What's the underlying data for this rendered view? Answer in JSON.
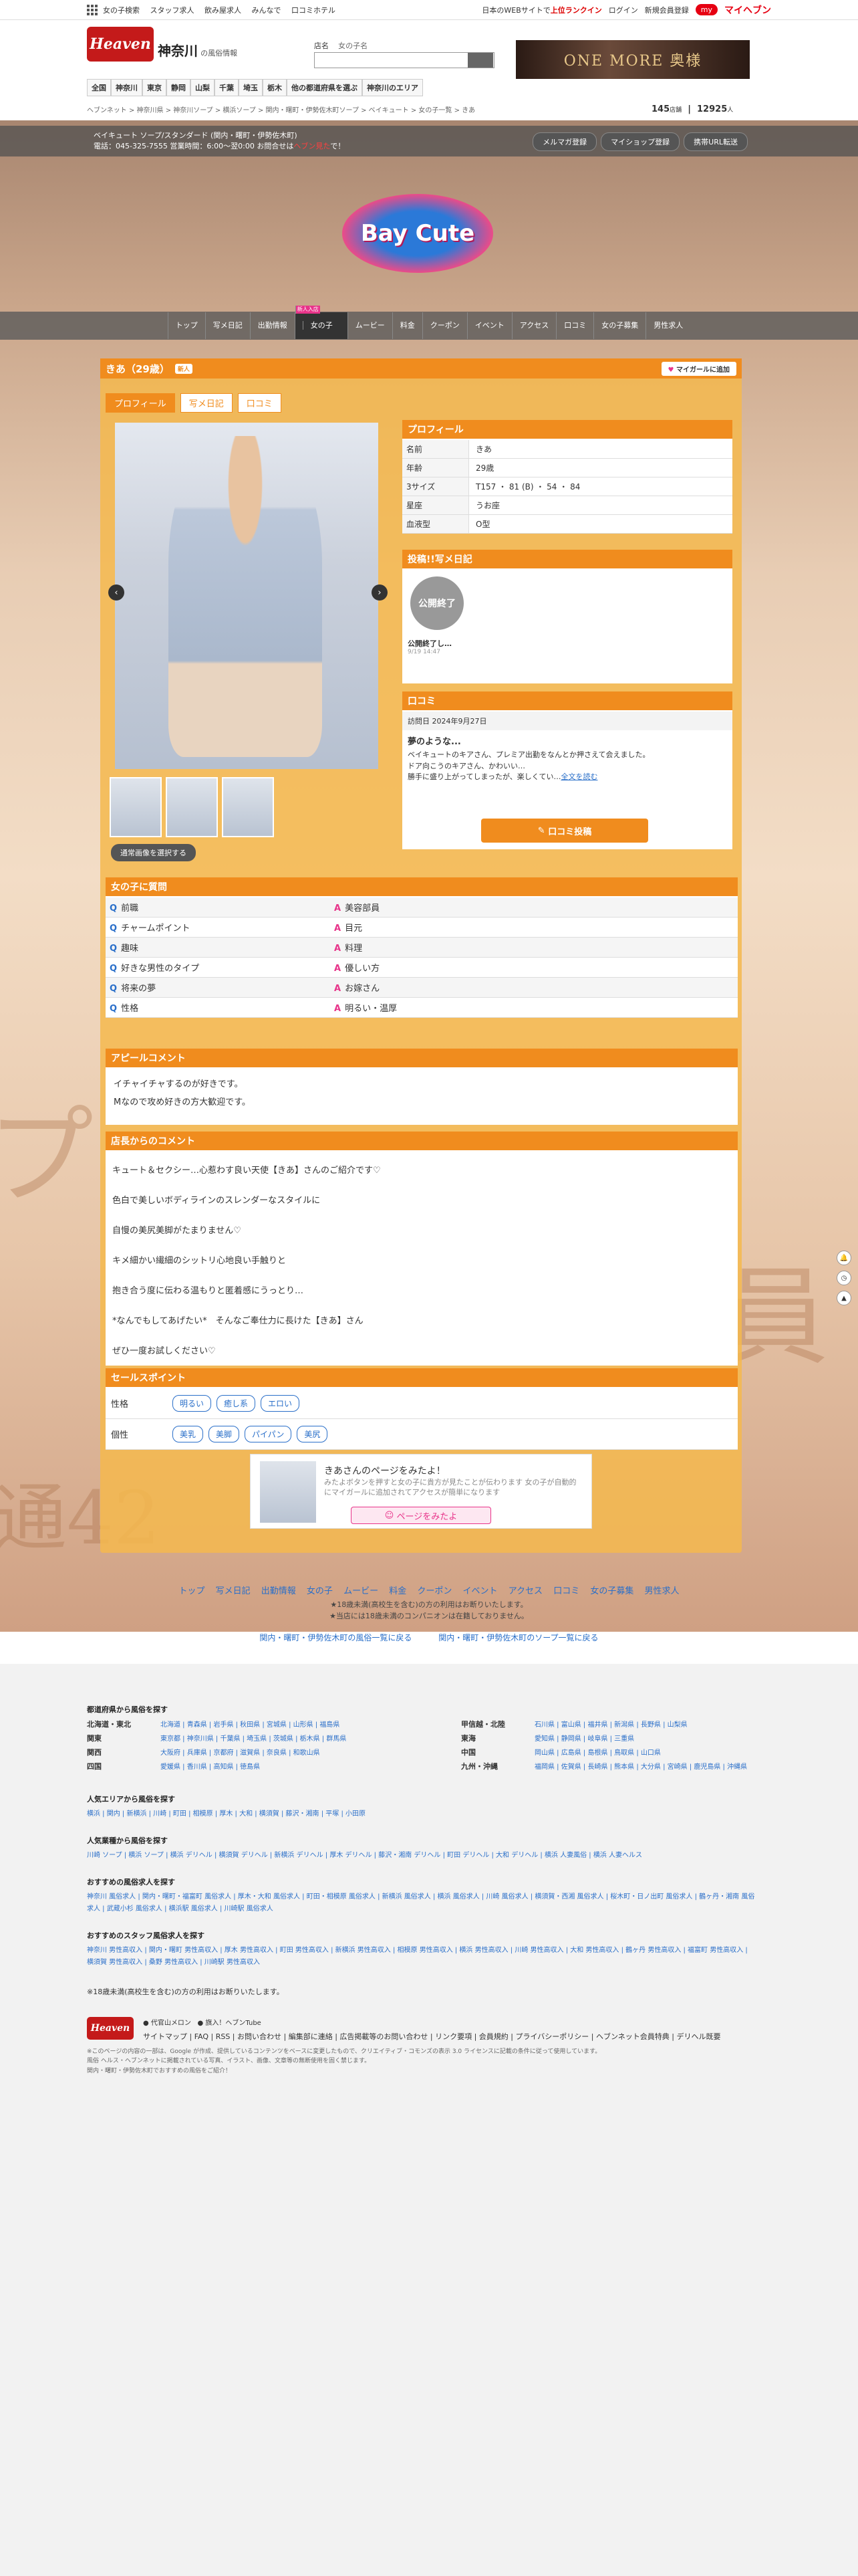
{
  "topbar": {
    "links": [
      "女の子検索",
      "スタッフ求人",
      "飲み屋求人",
      "みんなで",
      "口コミホテル"
    ],
    "right_text": "日本のWEBサイトで",
    "rank_text": "上位ランクイン",
    "login": "ログイン",
    "register": "新規会員登録",
    "my_badge": "my",
    "my_label": "マイヘブン"
  },
  "header": {
    "logo_text": "Heaven",
    "region_big": "神奈川",
    "region_small": "の風俗情報",
    "search_label": "店名",
    "search_value": "女の子名",
    "banner_text": "ONE MORE 奥様"
  },
  "areanav": [
    "全国",
    "神奈川",
    "東京",
    "静岡",
    "山梨",
    "千葉",
    "埼玉",
    "栃木",
    "他の都道府県を選ぶ",
    "神奈川のエリア"
  ],
  "breadcrumb": "ヘブンネット > 神奈川県 > 神奈川ソープ > 横浜ソープ > 関内・曙町・伊勢佐木町ソープ > ベイキュート > 女の子一覧 > きあ",
  "counts": {
    "shops": "145",
    "shops_unit": "店舗",
    "girls": "12925",
    "girls_unit": "人"
  },
  "shopbar": {
    "line1": "ベイキュート ソープ/スタンダード (関内・曙町・伊勢佐木町)",
    "line2": "電話：045-325-7555 営業時間：6:00〜翌0:00 お問合せは",
    "line2_highlight": "ヘブン見た",
    "line2_end": "で！",
    "buttons": [
      "メルマガ登録",
      "マイショップ登録",
      "携帯URL転送"
    ]
  },
  "shop_logo": "Bay Cute",
  "shopnav": [
    "トップ",
    "写メ日記",
    "出勤情報",
    "女の子",
    "ムービー",
    "料金",
    "クーポン",
    "イベント",
    "アクセス",
    "口コミ",
    "女の子募集",
    "男性求人"
  ],
  "shopnav_badge": "新人入店",
  "girl": {
    "name": "きあ（29歳）",
    "badge": "新人",
    "mylist": "マイガールに追加",
    "tabs": [
      "プロフィール",
      "写メ日記",
      "口コミ"
    ]
  },
  "profile": {
    "title": "プロフィール",
    "rows": [
      {
        "k": "名前",
        "v": "きあ"
      },
      {
        "k": "年齢",
        "v": "29歳"
      },
      {
        "k": "3サイズ",
        "v": "T157 ・ 81 (B) ・ 54 ・ 84"
      },
      {
        "k": "星座",
        "v": "うお座"
      },
      {
        "k": "血液型",
        "v": "O型"
      }
    ]
  },
  "diary": {
    "title": "投稿!!写メ日記",
    "card_circle": "公開終了",
    "card_title": "公開終了し…",
    "card_date": "9/19 14:47"
  },
  "review": {
    "title": "口コミ",
    "date": "訪問日  2024年9月27日",
    "heading": "夢のような...",
    "body1": "ベイキュートのキアさん、プレミア出勤をなんとか押さえて会えました。",
    "body2": "ドア向こうのキアさん、かわいい…",
    "body3": "勝手に盛り上がってしまったが、楽しくてい…",
    "more": "全文を読む",
    "post_button": "口コミ投稿"
  },
  "photo_controls": {
    "prev": "‹",
    "next": "›",
    "select_button": "通常画像を選択する"
  },
  "qa": {
    "title": "女の子に質問",
    "rows": [
      {
        "q": "前職",
        "a": "美容部員"
      },
      {
        "q": "チャームポイント",
        "a": "目元"
      },
      {
        "q": "趣味",
        "a": "料理"
      },
      {
        "q": "好きな男性のタイプ",
        "a": "優しい方"
      },
      {
        "q": "将来の夢",
        "a": "お嫁さん"
      },
      {
        "q": "性格",
        "a": "明るい・温厚"
      }
    ]
  },
  "appeal": {
    "title": "アピールコメント",
    "line1": "イチャイチャするのが好きです。",
    "line2": "Mなので攻め好きの方大歓迎です。"
  },
  "shop_comment": {
    "title": "店長からのコメント",
    "lines": [
      "キュート＆セクシー…心惹わす良い天使【きあ】さんのご紹介です♡",
      "色白で美しいボディラインのスレンダーなスタイルに",
      "自慢の美尻美脚がたまりません♡",
      "キメ細かい繊細のシットリ心地良い手触りと",
      "抱き合う度に伝わる温もりと匿着感にうっとり…",
      "*なんでもしてあげたい*　そんなご奉仕力に長けた【きあ】さん",
      "ぜひ一度お試しください♡"
    ]
  },
  "sales": {
    "title": "セールスポイント",
    "rows": [
      {
        "k": "性格",
        "tags": [
          "明るい",
          "癒し系",
          "エロい"
        ]
      },
      {
        "k": "個性",
        "tags": [
          "美乳",
          "美脚",
          "パイパン",
          "美尻"
        ]
      }
    ]
  },
  "promo": {
    "title": "きあさんのページをみたよ！",
    "text": "みたよボタンを押すと女の子に貴方が見たことが伝わります 女の子が自動的にマイガールに追加されてアクセスが簡単になります",
    "button": "ページをみたよ"
  },
  "footnav": [
    "トップ",
    "写メ日記",
    "出勤情報",
    "女の子",
    "ムービー",
    "料金",
    "クーポン",
    "イベント",
    "アクセス",
    "口コミ",
    "女の子募集",
    "男性求人"
  ],
  "age_note1": "★18歳未満(高校生を含む)の方の利用はお断りいたします。",
  "age_note2": "★当店には18歳未満のコンパニオンは在籍しておりません。",
  "backlinks": [
    "関内・曙町・伊勢佐木町の風俗一覧に戻る",
    "関内・曙町・伊勢佐木町のソープ一覧に戻る"
  ],
  "footer": {
    "pref_title": "都道府県から風俗を探す",
    "pref_left": [
      {
        "k": "北海道・東北",
        "v": "北海道 | 青森県 | 岩手県 | 秋田県 | 宮城県 | 山形県 | 福島県"
      },
      {
        "k": "関東",
        "v": "東京都 | 神奈川県 | 千葉県 | 埼玉県 | 茨城県 | 栃木県 | 群馬県"
      },
      {
        "k": "関西",
        "v": "大阪府 | 兵庫県 | 京都府 | 滋賀県 | 奈良県 | 和歌山県"
      },
      {
        "k": "四国",
        "v": "愛媛県 | 香川県 | 高知県 | 徳島県"
      }
    ],
    "pref_right": [
      {
        "k": "甲信越・北陸",
        "v": "石川県 | 富山県 | 福井県 | 新潟県 | 長野県 | 山梨県"
      },
      {
        "k": "東海",
        "v": "愛知県 | 静岡県 | 岐阜県 | 三重県"
      },
      {
        "k": "中国",
        "v": "岡山県 | 広島県 | 島根県 | 鳥取県 | 山口県"
      },
      {
        "k": "九州・沖縄",
        "v": "福岡県 | 佐賀県 | 長崎県 | 熊本県 | 大分県 | 宮崎県 | 鹿児島県 | 沖縄県"
      }
    ],
    "popular_title": "人気エリアから風俗を探す",
    "popular": "横浜 | 関内 | 新横浜 | 川崎 | 町田 | 相模原 | 厚木 | 大和 | 横須賀 | 藤沢・湘南 | 平塚 | 小田原",
    "type_title": "人気業種から風俗を探す",
    "types": "川崎 ソープ | 横浜 ソープ | 横浜 デリヘル | 横須賀 デリヘル | 新横浜 デリヘル | 厚木 デリヘル | 藤沢・湘南 デリヘル | 町田 デリヘル | 大和 デリヘル | 横浜 人妻風俗 | 横浜 人妻ヘルス",
    "job_title": "おすすめの風俗求人を探す",
    "jobs": "神奈川 風俗求人 | 関内・曙町・福富町 風俗求人 | 厚木・大和 風俗求人 | 町田・相模原 風俗求人 | 新横浜 風俗求人 | 横浜 風俗求人 | 川崎 風俗求人 | 横須賀・西湘 風俗求人 | 桜木町・日ノ出町 風俗求人 | 鶴ヶ丹・湘南 風俗求人 | 武蔵小杉 風俗求人 | 横浜駅 風俗求人 | 川崎駅 風俗求人",
    "staff_title": "おすすめのスタッフ風俗求人を探す",
    "staff": "神奈川 男性高収入 | 関内・曙町 男性高収入 | 厚木 男性高収入 | 町田 男性高収入 | 新横浜 男性高収入 | 相模原 男性高収入 | 横浜 男性高収入 | 川崎 男性高収入 | 大和 男性高収入 | 鶴ヶ丹 男性高収入 | 福富町 男性高収入 | 横須賀 男性高収入 | 桑野 男性高収入 | 川崎駅 男性高収入",
    "age_note": "※18歳未満(高校生を含む)の方の利用はお断りいたします。",
    "logo": "Heaven",
    "partner1": "代官山メロン",
    "partner2": "旗入！ヘブンTube",
    "links": "サイトマップ | FAQ | RSS | お問い合わせ | 編集部に連絡 | 広告掲載等のお問い合わせ | リンク要項 | 会員規約 | プライバシーポリシー | ヘブンネット会員特典 | デリヘル既要",
    "small1": "※このページの内容の一部は、Google が作成、提供しているコンテンツをベースに変更したもので、クリエイティブ・コモンズの表示 3.0 ライセンスに記載の条件に従って使用しています。",
    "small2": "風俗 ヘルス・ヘブンネットに掲載されている写真、イラスト、画像、文章等の無断使用を固く禁じます。",
    "small3": "関内・曙町・伊勢佐木町でおすすめの風俗をご紹介！"
  }
}
